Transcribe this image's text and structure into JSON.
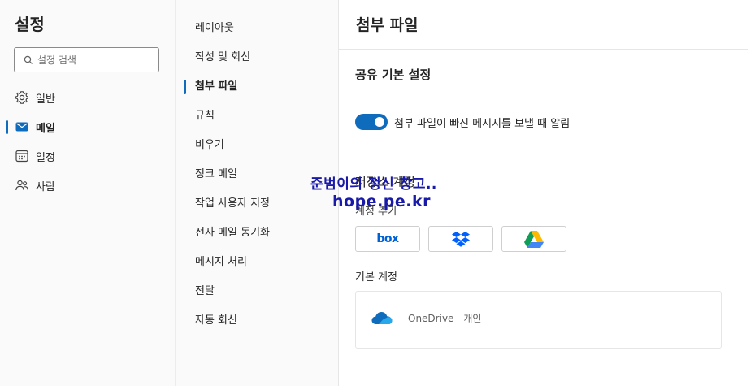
{
  "settings_title": "설정",
  "search": {
    "placeholder": "설정 검색"
  },
  "nav": [
    {
      "label": "일반",
      "icon": "gear-icon"
    },
    {
      "label": "메일",
      "icon": "mail-icon",
      "active": true
    },
    {
      "label": "일정",
      "icon": "calendar-icon"
    },
    {
      "label": "사람",
      "icon": "people-icon"
    }
  ],
  "subnav": [
    {
      "label": "레이아웃"
    },
    {
      "label": "작성 및 회신"
    },
    {
      "label": "첨부 파일",
      "active": true
    },
    {
      "label": "규칙"
    },
    {
      "label": "비우기"
    },
    {
      "label": "정크 메일"
    },
    {
      "label": "작업 사용자 지정"
    },
    {
      "label": "전자 메일 동기화"
    },
    {
      "label": "메시지 처리"
    },
    {
      "label": "전달"
    },
    {
      "label": "자동 회신"
    }
  ],
  "panel": {
    "title": "첨부 파일",
    "sharing_heading": "공유 기본 설정",
    "toggle_label": "첨부 파일이 빠진 메시지를 보낼 때 알림",
    "toggle_on": true,
    "storage_heading": "저장소 계정",
    "add_account_label": "계정 추가",
    "services": [
      {
        "name": "box",
        "icon": "box-logo-icon"
      },
      {
        "name": "Dropbox",
        "icon": "dropbox-icon"
      },
      {
        "name": "Google Drive",
        "icon": "google-drive-icon"
      }
    ],
    "default_account_label": "기본 계정",
    "default_account": "OneDrive - 개인"
  },
  "watermark": {
    "line1": "준범이의 정신 창고..",
    "line2": "hope.pe.kr"
  },
  "colors": {
    "accent": "#0f6cbd",
    "watermark": "#1a1aa8"
  }
}
